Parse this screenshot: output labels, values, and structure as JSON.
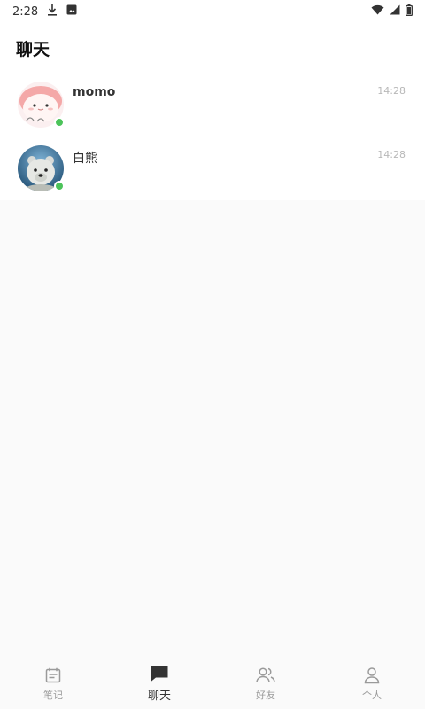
{
  "status_bar": {
    "time": "2:28",
    "icons": [
      "download-icon",
      "gallery-icon",
      "wifi-icon",
      "signal-icon",
      "battery-icon"
    ]
  },
  "header": {
    "title": "聊天"
  },
  "chats": [
    {
      "name": "momo",
      "time": "14:28",
      "online": true,
      "avatar_icon": "pink-cartoon-avatar"
    },
    {
      "name": "白熊",
      "time": "14:28",
      "online": true,
      "avatar_icon": "polar-bear-avatar"
    }
  ],
  "nav": {
    "items": [
      {
        "label": "笔记",
        "icon": "notes-icon",
        "active": false
      },
      {
        "label": "聊天",
        "icon": "chat-icon",
        "active": true
      },
      {
        "label": "好友",
        "icon": "friends-icon",
        "active": false
      },
      {
        "label": "个人",
        "icon": "profile-icon",
        "active": false
      }
    ]
  },
  "colors": {
    "online": "#4cc35a",
    "active_nav": "#333333",
    "inactive_nav": "#9a9a9a"
  }
}
